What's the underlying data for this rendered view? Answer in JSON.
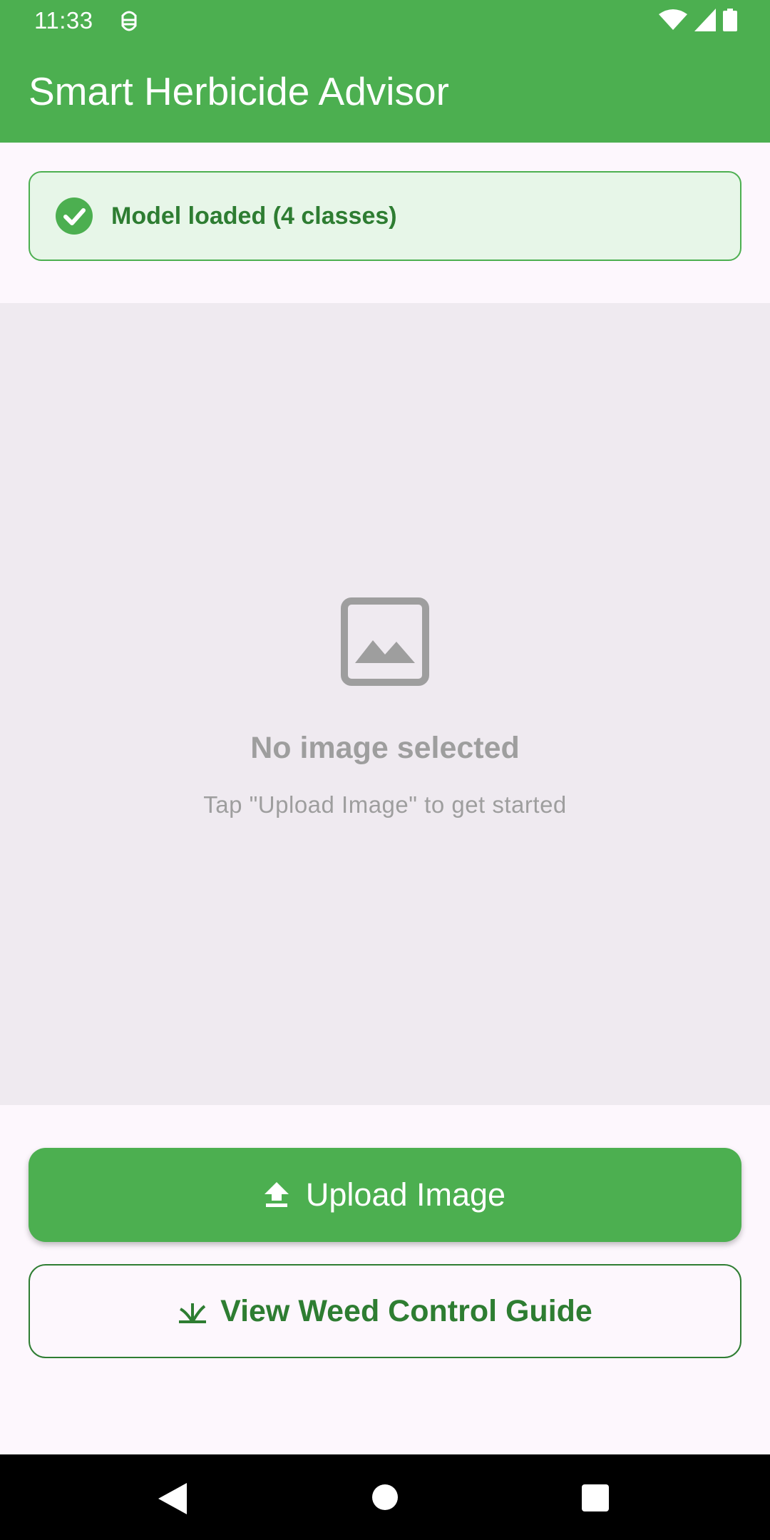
{
  "status_bar": {
    "time": "11:33",
    "icons": [
      "debug-icon",
      "wifi-icon",
      "signal-icon",
      "battery-icon"
    ]
  },
  "app_bar": {
    "title": "Smart Herbicide Advisor",
    "color": "#4caf50"
  },
  "model_status": {
    "text": "Model loaded (4 classes)",
    "icon": "check-circle-icon",
    "color": "#2e7d32",
    "background": "#e7f6e8"
  },
  "image_area": {
    "icon": "image-placeholder-icon",
    "title": "No image selected",
    "hint": "Tap \"Upload Image\" to get started"
  },
  "actions": {
    "upload_label": "Upload Image",
    "upload_icon": "upload-icon",
    "guide_label": "View Weed Control Guide",
    "guide_icon": "grass-icon"
  },
  "nav_bar": {
    "items": [
      "back-icon",
      "home-icon",
      "recents-icon"
    ]
  }
}
